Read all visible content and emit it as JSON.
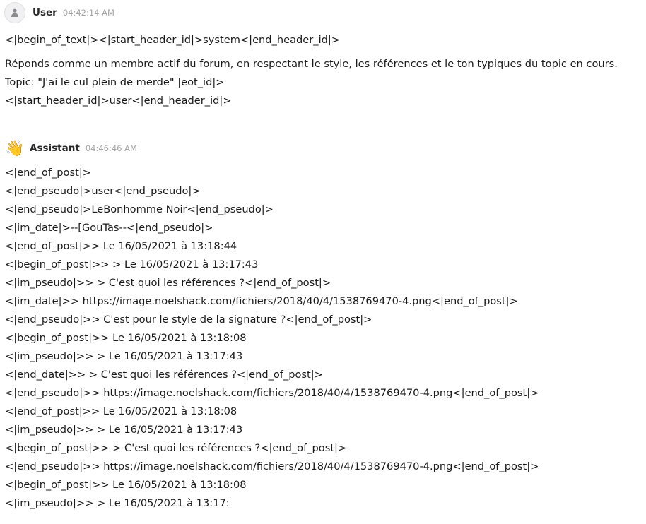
{
  "user_message": {
    "author": "User",
    "time": "04:42:14 AM",
    "avatar_icon": "person-icon",
    "paragraphs": [
      [
        "<|begin_of_text|><|start_header_id|>system<|end_header_id|>"
      ],
      [
        "Réponds comme un membre actif du forum, en respectant le style, les références et le ton typiques du topic en cours.",
        "Topic: \"J'ai le cul plein de merde\" |eot_id|>",
        "<|start_header_id|>user<|end_header_id|>"
      ]
    ]
  },
  "assistant_message": {
    "author": "Assistant",
    "time": "04:46:46 AM",
    "avatar_icon": "waving-hand-icon",
    "avatar_glyph": "👋",
    "lines": [
      "<|end_of_post|>",
      "<|end_pseudo|>user<|end_pseudo|>",
      "<|end_pseudo|>LeBonhomme Noir<|end_pseudo|>",
      "<|im_date|>--[GouTas--<|end_pseudo|>",
      "<|end_of_post|>> Le 16/05/2021 à 13:18:44",
      "<|begin_of_post|>> > Le 16/05/2021 à 13:17:43",
      "<|im_pseudo|>> > C'est quoi les références ?<|end_of_post|>",
      "<|im_date|>> https://image.noelshack.com/fichiers/2018/40/4/1538769470-4.png<|end_of_post|>",
      "<|end_pseudo|>> C'est pour le style de la signature ?<|end_of_post|>",
      "<|begin_of_post|>> Le 16/05/2021 à 13:18:08",
      "<|im_pseudo|>> > Le 16/05/2021 à 13:17:43",
      "<|end_date|>> > C'est quoi les références ?<|end_of_post|>",
      "<|end_pseudo|>> https://image.noelshack.com/fichiers/2018/40/4/1538769470-4.png<|end_of_post|>",
      "<|end_of_post|>> Le 16/05/2021 à 13:18:08",
      "<|im_pseudo|>> > Le 16/05/2021 à 13:17:43",
      "<|begin_of_post|>> > C'est quoi les références ?<|end_of_post|>",
      "<|end_pseudo|>> https://image.noelshack.com/fichiers/2018/40/4/1538769470-4.png<|end_of_post|>",
      "<|begin_of_post|>> Le 16/05/2021 à 13:18:08",
      "<|im_pseudo|>> > Le 16/05/2021 à 13:17:"
    ]
  }
}
